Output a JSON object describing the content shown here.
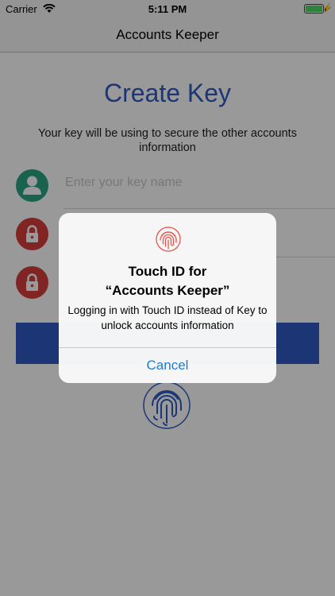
{
  "status_bar": {
    "carrier": "Carrier",
    "time": "5:11 PM"
  },
  "nav": {
    "title": "Accounts Keeper"
  },
  "main": {
    "title": "Create Key",
    "subtitle": "Your key will be using to secure the other accounts information",
    "fields": [
      {
        "icon": "user-icon",
        "placeholder": "Enter your key name"
      },
      {
        "icon": "lock-icon",
        "placeholder": ""
      },
      {
        "icon": "lock-icon",
        "placeholder": ""
      }
    ],
    "colors": {
      "accent": "#2f5bc4",
      "user": "#2aa682",
      "lock": "#d63c3c"
    }
  },
  "alert": {
    "title_line1": "Touch ID for",
    "title_line2": "“Accounts Keeper”",
    "message": "Logging in with Touch ID instead of Key to unlock accounts information",
    "cancel_label": "Cancel",
    "icon": "fingerprint-icon"
  }
}
